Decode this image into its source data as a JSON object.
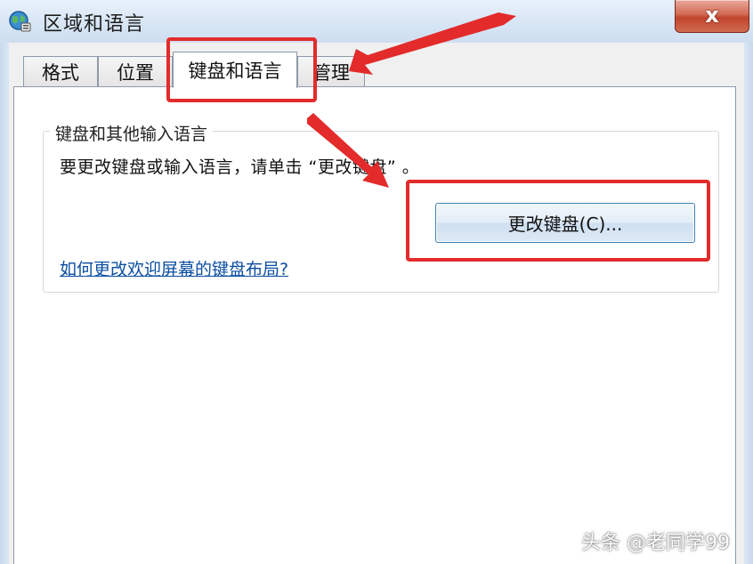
{
  "window": {
    "title": "区域和语言",
    "close_symbol": "x",
    "icon": "globe-icon"
  },
  "tabs": [
    {
      "label": "格式",
      "active": false
    },
    {
      "label": "位置",
      "active": false
    },
    {
      "label": "键盘和语言",
      "active": true
    },
    {
      "label": "管理",
      "active": false
    }
  ],
  "keyboard_group": {
    "legend": "键盘和其他输入语言",
    "instruction": "要更改键盘或输入语言，请单击 “更改键盘” 。",
    "change_button_label": "更改键盘(C)...",
    "help_link": "如何更改欢迎屏幕的键盘布局?"
  },
  "annotations": {
    "highlight_color": "#e32b2b"
  },
  "watermark": "头条 @老同学99"
}
